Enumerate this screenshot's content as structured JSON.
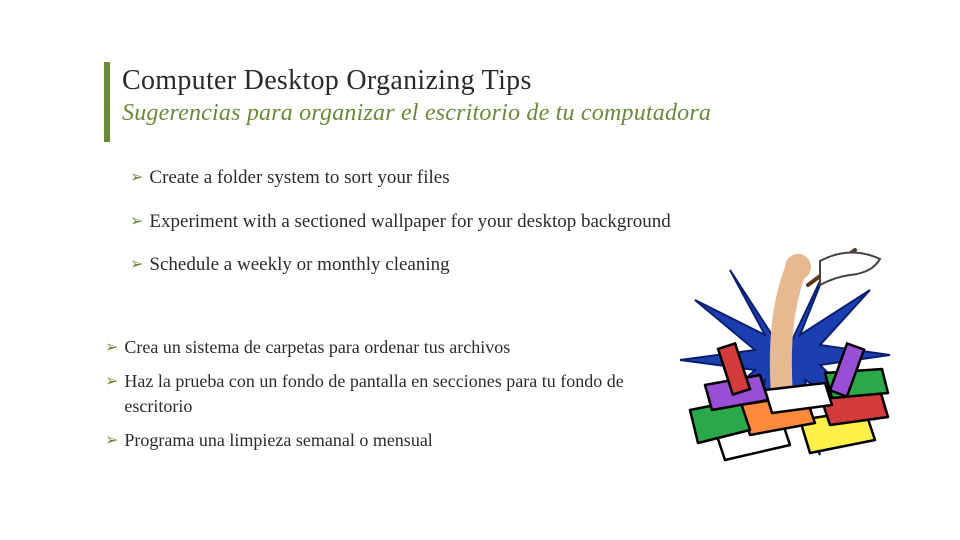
{
  "title": {
    "en": "Computer Desktop Organizing Tips",
    "es": "Sugerencias para organizar el escritorio de tu computadora"
  },
  "bullets_en": [
    "Create a folder system to sort your files",
    "Experiment with a sectioned wallpaper for your desktop background",
    "Schedule a weekly or monthly cleaning"
  ],
  "bullets_es": [
    "Crea un sistema de carpetas para ordenar tus archivos",
    "Haz la prueba con un fondo de pantalla en secciones para tu fondo de escritorio",
    "Programa una limpieza semanal o mensual"
  ],
  "bullet_glyph": "➢",
  "colors": {
    "accent": "#6a8a3a",
    "text": "#2b2b2b"
  },
  "illustration": "clutter-arm-flag"
}
